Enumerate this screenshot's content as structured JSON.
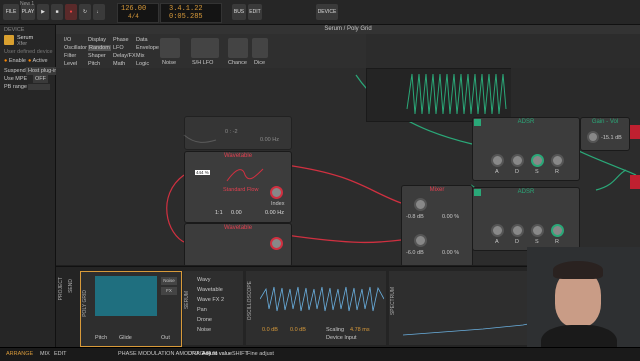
{
  "topbar": {
    "file": "FILE",
    "play": "PLAY",
    "tempo": "126.00",
    "time_sig": "4/4",
    "pos_top": "3.4.1.22",
    "pos_bottom": "0:05.285",
    "bus": "BUS",
    "edit": "EDIT",
    "device": "DEVICE",
    "project_tab": "New 1"
  },
  "inspector": {
    "device_header": "DEVICE",
    "device_name": "Serum",
    "device_vendor": "Xfer",
    "preset": "User defined device",
    "enable": "Enable",
    "active": "Active",
    "suspend": "Suspend",
    "suspend_val": "Host plug-in",
    "use_mpe": "Use MPE",
    "use_mpe_val": "OFF",
    "pb_range": "PB range"
  },
  "grid": {
    "breadcrumb": "Serum / Poly Grid",
    "categories": [
      [
        "I/O",
        "Oscillator",
        "Filter",
        "Level"
      ],
      [
        "Display",
        "Random",
        "Shaper",
        "Pitch"
      ],
      [
        "Phase",
        "LFO",
        "Delay/FX",
        "Math"
      ],
      [
        "Data",
        "Envelope",
        "Mix",
        "Logic"
      ]
    ],
    "palette": [
      "Noise",
      "S/H LFO",
      "Chance",
      "Dice"
    ],
    "modules": {
      "wavetable1": "Wavetable",
      "wavetable2": "Wavetable",
      "wt_index": "Index",
      "wt_frame": "Standard Flow",
      "wt_ratio": "1:1",
      "wt_cents": "0.00",
      "wt_hz": "0.00 Hz",
      "wt_badge": "444 %",
      "mixer": "Mixer",
      "mixer_db1": "-0.8 dB",
      "mixer_pct1": "0.00 %",
      "mixer_db2": "-6.0 dB",
      "mixer_pct2": "0.00 %",
      "adsr1": "ADSR",
      "adsr2": "ADSR",
      "adsr_labels": [
        "A",
        "D",
        "S",
        "R"
      ],
      "gain": "Gain - Vol",
      "gain_val": "-15.1 dB",
      "muted_vals": "0 : -2",
      "muted_hz": "0.00 Hz"
    }
  },
  "bottom": {
    "tabs": [
      "PROJECT",
      "SEND",
      "POLY GRID",
      "SERUM",
      "OSCILLOSCOPE",
      "SPECTRUM"
    ],
    "presets": [
      "Wavy",
      "Wavetable",
      "Wave FX 2",
      "Pan",
      "Drone",
      "Noise"
    ],
    "knobs": [
      "Pitch",
      "Glide",
      "Out"
    ],
    "noise_fx": "Noise FX",
    "fx": "FX",
    "scope_val1": "0.0 dB",
    "scope_val2": "0.0 dB",
    "scope_scaling": "Scaling",
    "scope_ms": "4.78 ms",
    "device_input": "Device Input"
  },
  "status": {
    "arrange": "ARRANGE",
    "mix": "MIX",
    "edit": "EDIT",
    "hint1": "PHASE MODULATION AMOUNT: 444 %",
    "drag": "DRAG",
    "drag_hint": "Adjust value",
    "shift": "SHIFT",
    "shift_hint": "Fine adjust"
  }
}
